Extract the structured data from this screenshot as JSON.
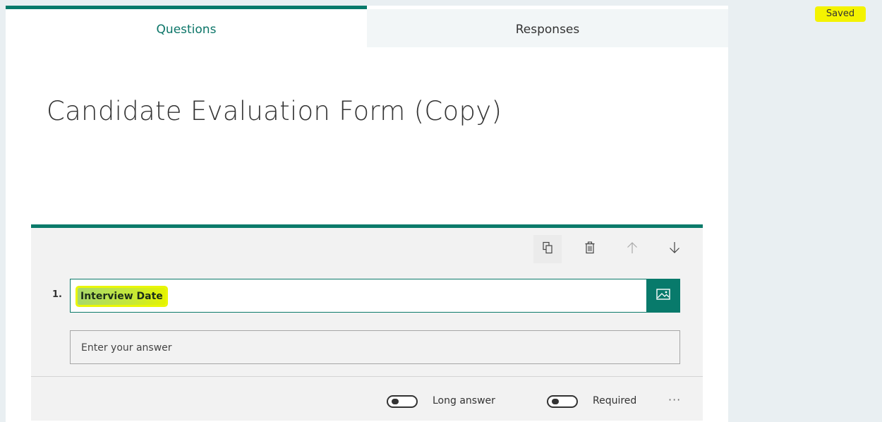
{
  "status": {
    "saved": "Saved"
  },
  "tabs": [
    {
      "label": "Questions"
    },
    {
      "label": "Responses"
    }
  ],
  "form": {
    "title": "Candidate Evaluation Form (Copy)"
  },
  "question": {
    "number": "1.",
    "title": "Interview Date",
    "answer_placeholder": "Enter your answer",
    "toolbar_icons": [
      "copy-icon",
      "delete-icon",
      "arrow-up-icon",
      "arrow-down-icon"
    ],
    "image_icon": "image-icon",
    "long_answer_label": "Long answer",
    "long_answer_on": false,
    "required_label": "Required",
    "required_on": false,
    "more_label": "···"
  },
  "colors": {
    "accent": "#087a6b",
    "highlight": "#f4f300",
    "background": "#e9eff2"
  }
}
